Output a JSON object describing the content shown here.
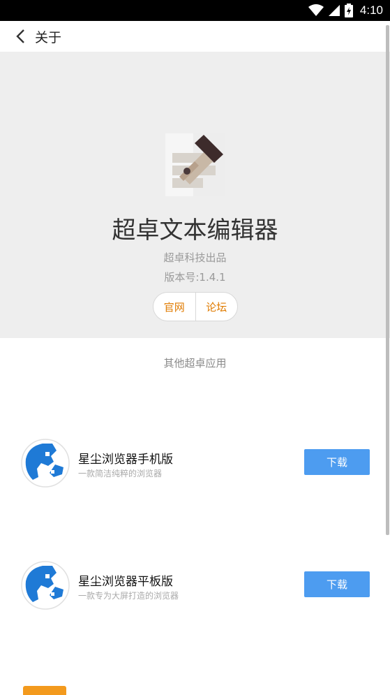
{
  "status": {
    "time": "4:10"
  },
  "toolbar": {
    "title": "关于"
  },
  "app": {
    "name": "超卓文本编辑器",
    "publisher": "超卓科技出品",
    "version": "版本号:1.4.1",
    "links": [
      "官网",
      "论坛"
    ],
    "accent": "#e07b00"
  },
  "section": {
    "title": "其他超卓应用"
  },
  "apps": [
    {
      "name": "星尘浏览器手机版",
      "desc": "一款简洁纯粹的浏览器",
      "button": "下载"
    },
    {
      "name": "星尘浏览器平板版",
      "desc": "一款专为大屏打造的浏览器",
      "button": "下载"
    }
  ],
  "colors": {
    "download_button": "#4d9cf0",
    "header_bg": "#eeeeee"
  }
}
